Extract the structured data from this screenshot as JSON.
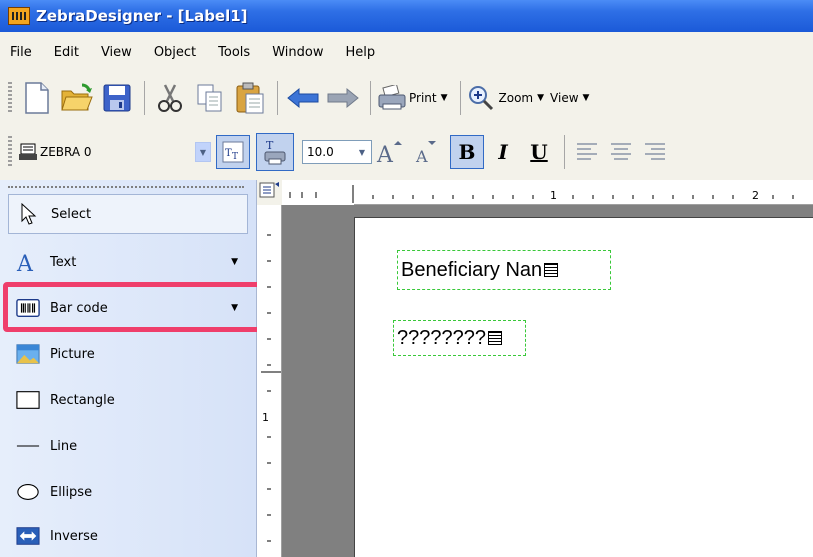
{
  "window": {
    "title": "ZebraDesigner - [Label1]"
  },
  "menu": [
    {
      "label": "File"
    },
    {
      "label": "Edit"
    },
    {
      "label": "View"
    },
    {
      "label": "Object"
    },
    {
      "label": "Tools"
    },
    {
      "label": "Window"
    },
    {
      "label": "Help"
    }
  ],
  "toolbar1": {
    "print_label": "Print",
    "zoom_label": "Zoom",
    "view_label": "View"
  },
  "toolbar2": {
    "printer_value": "ZEBRA 0",
    "font_size_value": "10.0",
    "bold": "B",
    "italic": "I",
    "underline": "U"
  },
  "tools": [
    {
      "label": "Select",
      "icon": "cursor-arrow-icon"
    },
    {
      "label": "Text",
      "icon": "text-a-icon"
    },
    {
      "label": "Bar code",
      "icon": "barcode-icon"
    },
    {
      "label": "Picture",
      "icon": "picture-icon"
    },
    {
      "label": "Rectangle",
      "icon": "rectangle-icon"
    },
    {
      "label": "Line",
      "icon": "line-icon"
    },
    {
      "label": "Ellipse",
      "icon": "ellipse-icon"
    },
    {
      "label": "Inverse",
      "icon": "inverse-icon"
    }
  ],
  "ruler": {
    "h_marks": [
      "1",
      "2"
    ],
    "v_marks": [
      "1"
    ]
  },
  "label_objects": [
    {
      "text": "Beneficiary Nan"
    },
    {
      "text": "????????"
    }
  ],
  "colors": {
    "titlebar": "#2e6fe6",
    "highlight": "#ef3e6b",
    "selection_dash": "#39c839"
  }
}
